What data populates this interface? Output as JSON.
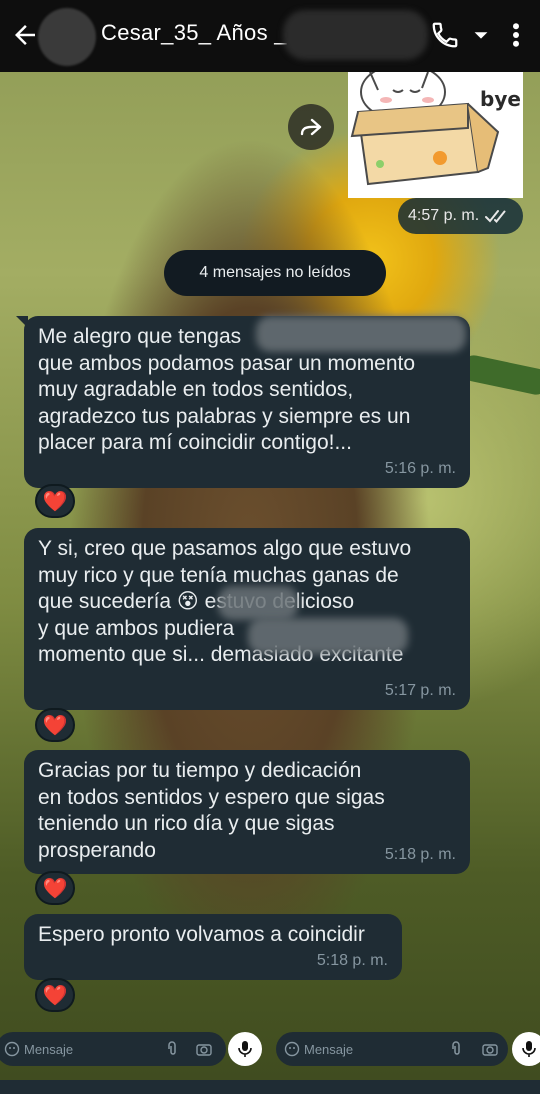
{
  "header": {
    "contact_name": "Cesar_35_ Años _",
    "back_icon": "back-arrow-icon",
    "call_icon": "phone-icon",
    "menu_icon": "more-vert-icon"
  },
  "sticker": {
    "text": "bye",
    "time": "4:57 p. m.",
    "status": "read"
  },
  "unread_divider": "4 mensajes no leídos",
  "messages": [
    {
      "text": "Me alegro que tengas\nque ambos podamos pasar un momento\nmuy agradable en todos sentidos,\nagradezco tus palabras y siempre es un\nplacer para mí coincidir contigo!...",
      "time": "5:16 p. m.",
      "reaction": "❤️"
    },
    {
      "text": "Y si, creo que pasamos algo que estuvo\nmuy rico y que tenía muchas ganas de\nque sucedería 😵 estuvo delicioso\ny que ambos pudiera\nmomento que si... demasiado excitante",
      "time": "5:17 p. m.",
      "reaction": "❤️"
    },
    {
      "text": "Gracias por tu tiempo y dedicación\nen todos sentidos y espero que sigas\nteniendo un rico día y que sigas\nprosperando",
      "time": "5:18 p. m.",
      "reaction": "❤️"
    },
    {
      "text": "Espero pronto volvamos a coincidir",
      "time": "5:18 p. m.",
      "reaction": "❤️"
    }
  ],
  "input": {
    "placeholder": "Mensaje"
  },
  "colors": {
    "header_bg": "#0e0e0e",
    "bubble_bg": "#1f2c34",
    "text": "#e9edef",
    "time_text": "#8696a0",
    "read_tick": "#53bdeb",
    "heart": "#e0245e"
  }
}
